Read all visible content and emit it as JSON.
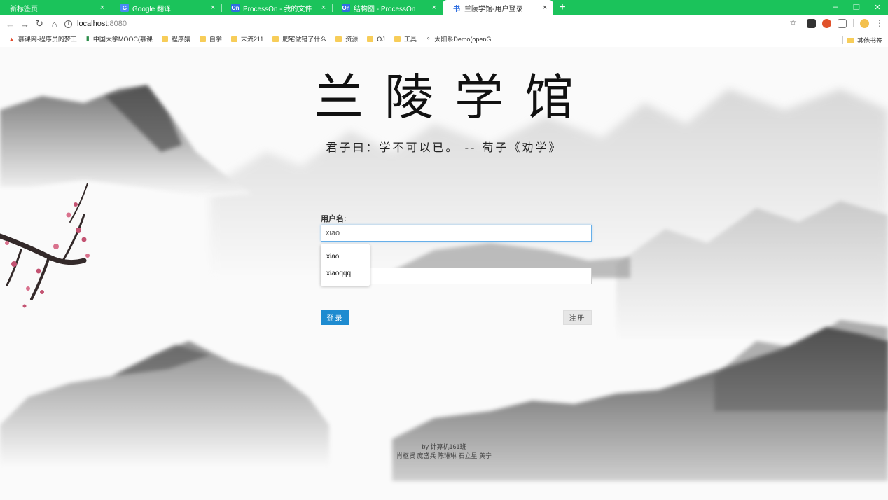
{
  "browser": {
    "tabs": [
      {
        "title": "新标签页",
        "icon": "",
        "active": false
      },
      {
        "title": "Google 翻译",
        "icon": "translate-icon",
        "active": false
      },
      {
        "title": "ProcessOn - 我的文件",
        "icon": "processon-icon",
        "active": false
      },
      {
        "title": "结构图 - ProcessOn",
        "icon": "processon-icon",
        "active": false
      },
      {
        "title": "兰陵学馆-用户登录",
        "icon": "book-icon",
        "active": true
      }
    ],
    "new_tab_label": "+",
    "tab_close_glyph": "×",
    "icon_labels": {
      "processon": "On",
      "book": "书"
    },
    "address": {
      "host": "localhost",
      "port": ":8080"
    },
    "bookmarks": [
      {
        "label": "慕课网-程序员的梦工",
        "icon": "fire-icon"
      },
      {
        "label": "中国大学MOOC(慕课",
        "icon": "mooc-icon"
      },
      {
        "label": "程序猿",
        "icon": "folder-icon"
      },
      {
        "label": "自学",
        "icon": "folder-icon"
      },
      {
        "label": "末流211",
        "icon": "folder-icon"
      },
      {
        "label": "肥宅做错了什么",
        "icon": "folder-icon"
      },
      {
        "label": "资源",
        "icon": "folder-icon"
      },
      {
        "label": "OJ",
        "icon": "folder-icon"
      },
      {
        "label": "工具",
        "icon": "folder-icon"
      },
      {
        "label": "太阳系Demo(openG",
        "icon": "solar-icon"
      }
    ],
    "other_bookmarks": "其他书签"
  },
  "page": {
    "title": "兰陵学馆",
    "motto": "君子曰：学不可以已。 -- 荀子《劝学》",
    "username_label": "用户名:",
    "username_value": "xiao",
    "autocomplete_options": [
      "xiao",
      "xiaoqqq"
    ],
    "login_button": "登录",
    "register_button": "注册",
    "footer_line1": "by 计算机161班",
    "footer_line2": "肖枢贤 庞盛兵 陈琳琳 石立星 黄宁"
  },
  "colors": {
    "chrome_green": "#1bc35b",
    "login_blue": "#1e8bd0",
    "register_gray": "#e6e6e6"
  }
}
